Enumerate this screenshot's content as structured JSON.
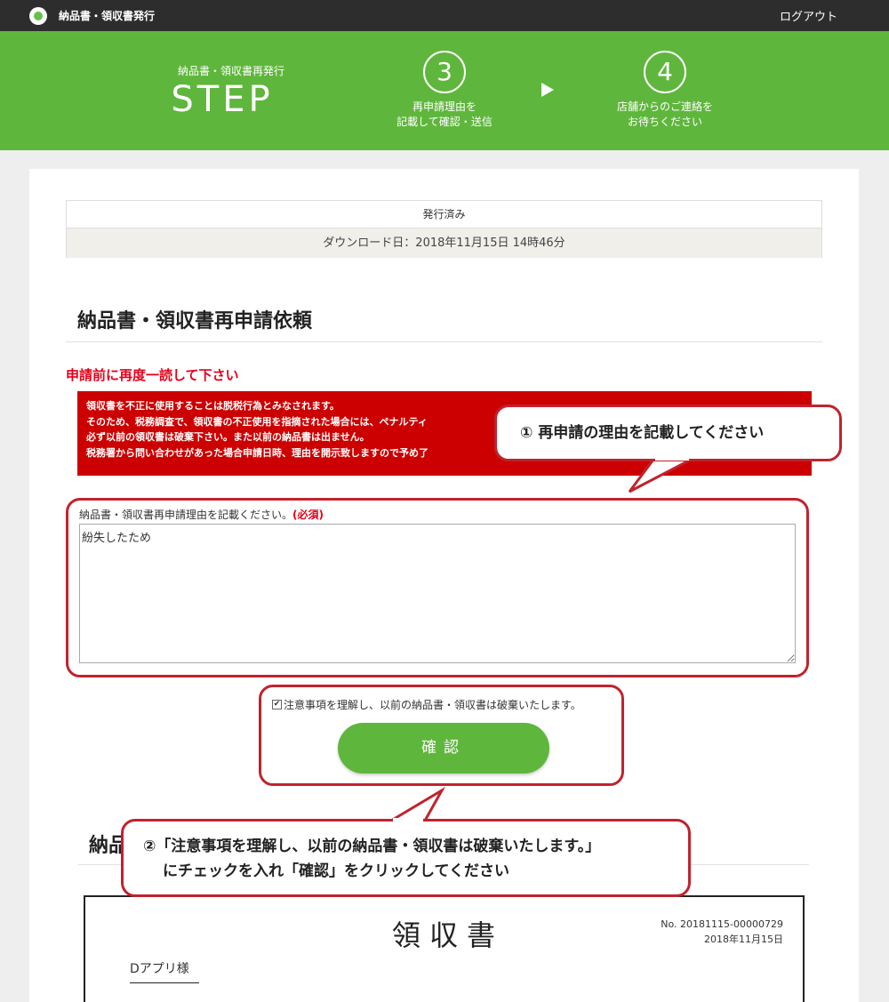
{
  "topbar": {
    "app_title": "納品書・領収書発行",
    "logout": "ログアウト"
  },
  "hero": {
    "subtitle": "納品書・領収書再発行",
    "step_word": "STEP",
    "steps": [
      {
        "number": "3",
        "line1": "再申請理由を",
        "line2": "記載して確認・送信"
      },
      {
        "number": "4",
        "line1": "店舗からのご連絡を",
        "line2": "お待ちください"
      }
    ]
  },
  "status": {
    "label": "発行済み",
    "download": "ダウンロード日：2018年11月15日 14時46分"
  },
  "form": {
    "title": "納品書・領収書再申請依頼",
    "warning_heading": "申請前に再度一読して下さい",
    "warning_lines": [
      "領収書を不正に使用することは脱税行為とみなされます。",
      "そのため、税務調査で、領収書の不正使用を指摘された場合には、ペナルティ",
      "必ず以前の領収書は破棄下さい。また以前の納品書は出ません。",
      "税務署から問い合わせがあった場合申請日時、理由を開示致しますので予め了"
    ],
    "field_label": "納品書・領収書再申請理由を記載ください。",
    "required_mark": "(必須)",
    "reason_value": "紛失したため",
    "agree_label": "注意事項を理解し、以前の納品書・領収書は破棄いたします。",
    "agree_checked": true,
    "confirm_label": "確認"
  },
  "preview": {
    "title_fragment": "納品",
    "receipt_title": "領収書",
    "receipt_no": "No. 20181115-00000729",
    "receipt_date": "2018年11月15日",
    "addressee": "Dアプリ様"
  },
  "callouts": {
    "first": "① 再申請の理由を記載してください",
    "second_line1": "②「注意事項を理解し、以前の納品書・領収書は破棄いたします。」",
    "second_line2": "にチェックを入れ「確認」をクリックしてください"
  },
  "colors": {
    "brand_green": "#5fb63c",
    "warning_red": "#cc0000",
    "callout_border": "#c0232e",
    "topbar": "#2d2d2d"
  }
}
